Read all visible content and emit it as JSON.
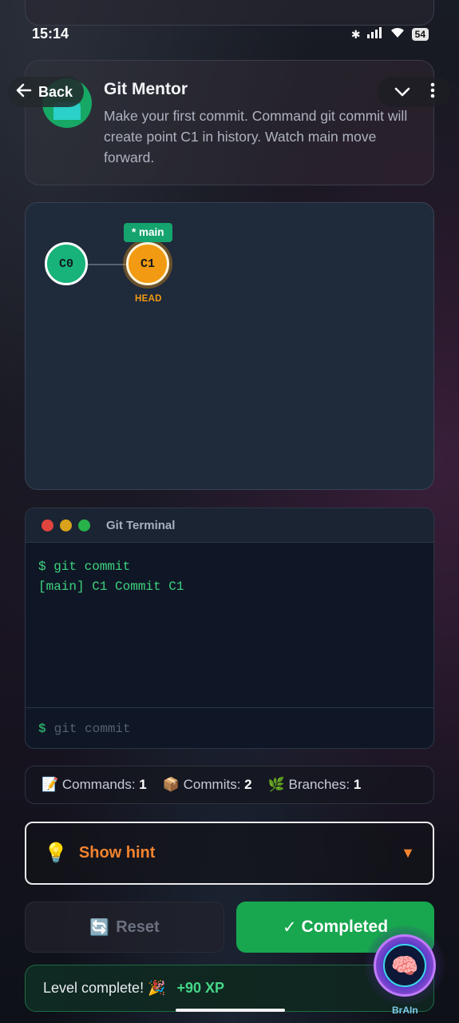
{
  "status_bar": {
    "time": "15:14",
    "battery": "54"
  },
  "header": {
    "back_label": "Back",
    "mentor_title": "Git Mentor",
    "mentor_text": "Make your first commit. Command git commit will create point C1 in history. Watch main move forward."
  },
  "graph": {
    "nodes": [
      "C0",
      "C1"
    ],
    "branch_tag": "* main",
    "head_label": "HEAD"
  },
  "terminal": {
    "title": "Git Terminal",
    "lines": [
      "$ git commit",
      "[main] C1 Commit C1"
    ],
    "prompt": "$",
    "input_placeholder": "git commit",
    "dot_colors": [
      "#e0443e",
      "#d9a21b",
      "#27b24a"
    ]
  },
  "stats": {
    "commands_label": "Commands:",
    "commands_value": "1",
    "commits_label": "Commits:",
    "commits_value": "2",
    "branches_label": "Branches:",
    "branches_value": "1"
  },
  "hint": {
    "label": "Show hint"
  },
  "actions": {
    "reset_label": "Reset",
    "completed_label": "Completed"
  },
  "level": {
    "text": "Level complete! 🎉",
    "xp": "+90 XP"
  },
  "brain": {
    "label": "BrAIn"
  },
  "colors": {
    "accent_green": "#18a64f",
    "head_orange": "#f29a11",
    "hint_orange": "#f1832f",
    "terminal_green": "#3ed37e"
  }
}
